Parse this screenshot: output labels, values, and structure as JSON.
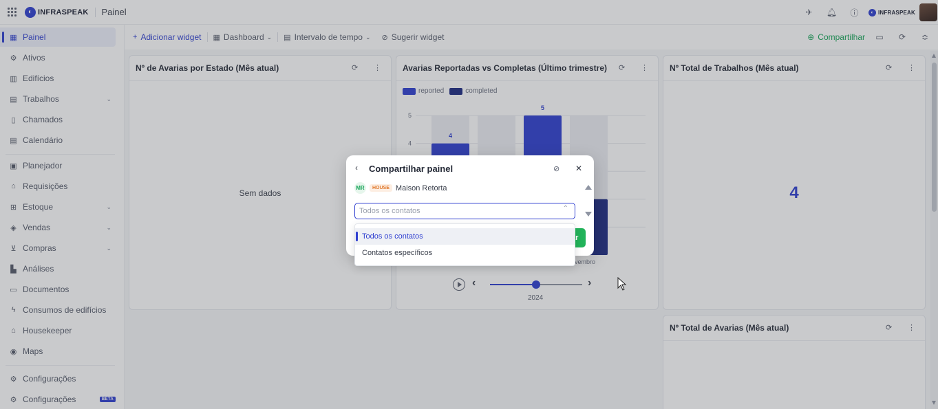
{
  "app": {
    "brand": "INFRASPEAK",
    "page_title": "Painel"
  },
  "sidebar": {
    "items": [
      {
        "label": "Painel",
        "icon": "dashboard-icon",
        "active": true
      },
      {
        "label": "Ativos",
        "icon": "assets-icon"
      },
      {
        "label": "Edifícios",
        "icon": "building-icon"
      },
      {
        "label": "Trabalhos",
        "icon": "calendar-icon",
        "chevron": true
      },
      {
        "label": "Chamados",
        "icon": "document-icon"
      },
      {
        "label": "Calendário",
        "icon": "calendar-icon"
      },
      {
        "label": "Planejador",
        "icon": "planner-icon"
      },
      {
        "label": "Requisições",
        "icon": "requests-icon"
      },
      {
        "label": "Estoque",
        "icon": "stock-icon",
        "chevron": true
      },
      {
        "label": "Vendas",
        "icon": "tag-icon",
        "chevron": true
      },
      {
        "label": "Compras",
        "icon": "cart-icon",
        "chevron": true
      },
      {
        "label": "Análises",
        "icon": "analytics-icon"
      },
      {
        "label": "Documentos",
        "icon": "documents-icon"
      },
      {
        "label": "Consumos de edifícios",
        "icon": "energy-icon"
      },
      {
        "label": "Housekeeper",
        "icon": "housekeeper-icon"
      },
      {
        "label": "Maps",
        "icon": "pin-icon"
      },
      {
        "label": "Configurações",
        "icon": "gear-icon"
      },
      {
        "label": "Configurações",
        "icon": "gear-icon",
        "badge": "BETA"
      }
    ]
  },
  "toolbar": {
    "add_widget": "Adicionar widget",
    "dashboard": "Dashboard",
    "time_range": "Intervalo de tempo",
    "suggest_widget": "Sugerir widget",
    "share": "Compartilhar"
  },
  "widgets": {
    "w1": {
      "title": "Nº de Avarias por Estado (Mês atual)",
      "empty": "Sem dados"
    },
    "w2": {
      "title": "Avarias Reportadas vs Completas (Último trimestre)"
    },
    "w3": {
      "title": "Nº Total de Trabalhos (Mês atual)",
      "value": "4"
    },
    "w4": {
      "title": "Nº Total de Avarias (Mês atual)"
    }
  },
  "chart_data": {
    "type": "bar",
    "series": [
      {
        "name": "reported",
        "color": "#2f3fd0",
        "values": [
          4,
          null,
          5,
          null
        ]
      },
      {
        "name": "completed",
        "color": "#1c2a82",
        "values": [
          null,
          null,
          null,
          2
        ]
      }
    ],
    "ylim": [
      0,
      5
    ],
    "yticks": [
      4,
      5
    ],
    "visible_x_label": "ovembro",
    "player_year": "2024",
    "player_progress": 0.5
  },
  "modal": {
    "title": "Compartilhar painel",
    "building": {
      "initials": "MR",
      "type": "HOUSE",
      "name": "Maison Retorta"
    },
    "select_placeholder": "Todos os contatos",
    "button_fragment": "ar",
    "options": [
      "Todos os contatos",
      "Contatos específicos"
    ]
  }
}
